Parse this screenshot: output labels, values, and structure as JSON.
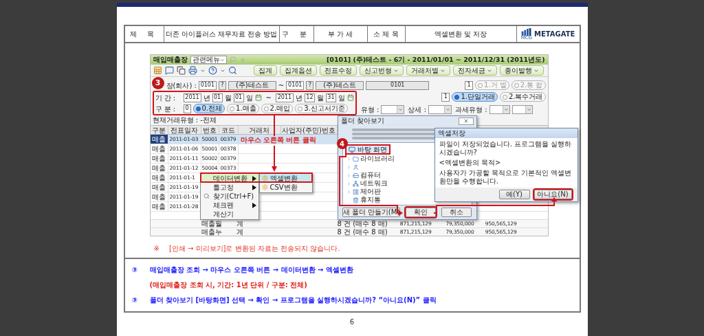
{
  "header": {
    "title_label": "제 목",
    "title": "더존 아이플러스 재무자료 전송 방법",
    "category_label": "구 분",
    "category": "부 가 세",
    "subtitle_label": "소 제 목",
    "subtitle": "엑셀변환 및 저장",
    "logo": {
      "name": "METAGATE",
      "sub": "MCG"
    }
  },
  "screenshot": {
    "title_bar": {
      "title": "매입매출장",
      "menu": "관련메뉴",
      "info": "[0101] (주)테스트 - 6기 - 2011/01/01 ~ 2011/12/31 (2011년도)"
    },
    "toolbar": [
      {
        "label": "집계",
        "dropdown": false
      },
      {
        "label": "집계옵션",
        "dropdown": false
      },
      {
        "label": "전표수정",
        "dropdown": false
      },
      {
        "label": "신고번형",
        "dropdown": true
      },
      {
        "label": "거래처별",
        "dropdown": true
      },
      {
        "label": "전자세금",
        "dropdown": true
      },
      {
        "label": "종이발행",
        "dropdown": true
      }
    ],
    "callout_3": "3",
    "company_row": {
      "label": "장(회사) :",
      "from_code": "0101",
      "from_help": "?",
      "from_name": "(주)테스트",
      "tilde": "~",
      "to_code": "0101",
      "to_help": "?",
      "to_name": "(주)테스트",
      "extra": "0101",
      "option_value": "1",
      "options": [
        {
          "label": "1.거 별",
          "selected": false,
          "disabled": true
        },
        {
          "label": "2.통 합",
          "selected": false,
          "disabled": true
        }
      ]
    },
    "period_row": {
      "label": "기 간 :",
      "from": [
        {
          "value": "2011",
          "unit": "년"
        },
        {
          "value": "01",
          "unit": "월"
        },
        {
          "value": "01",
          "unit": "일"
        }
      ],
      "tilde": "~",
      "to": [
        {
          "value": "2011",
          "unit": "년"
        },
        {
          "value": "12",
          "unit": "월"
        },
        {
          "value": "31",
          "unit": "일"
        }
      ],
      "option_value": "1",
      "options": [
        {
          "label": "1.단일거래",
          "selected": true
        },
        {
          "label": "2.복수거래",
          "selected": false
        }
      ]
    },
    "type_row": {
      "label": "구 분 :",
      "value": "0",
      "options": [
        {
          "label": "0.전체",
          "selected": true
        },
        {
          "label": "1.매출",
          "selected": false
        },
        {
          "label": "2.매입",
          "selected": false
        },
        {
          "label": "3.신고서기준",
          "selected": false
        }
      ],
      "filters": [
        {
          "label": "유형 :",
          "double": false
        },
        {
          "label": "상세 :",
          "double": false
        },
        {
          "label": "과세유형 :",
          "double": true
        }
      ]
    },
    "current_type": "현재거래유형 : -전체",
    "table": {
      "columns": [
        "구분",
        "전표일자",
        "번호",
        "코드",
        "거래처",
        "사업자(주민)번호"
      ],
      "rows": [
        {
          "type": "매출",
          "date": "2011-01-03",
          "number": "50001",
          "code": "00379",
          "selected": true
        },
        {
          "type": "매출",
          "date": "2011-01-06",
          "number": "50001",
          "code": "00378",
          "selected": false
        },
        {
          "type": "매출",
          "date": "2011-01-11",
          "number": "50002",
          "code": "00379",
          "selected": false
        },
        {
          "type": "매출",
          "date": "2011-01-12",
          "number": "50004",
          "code": "00373",
          "selected": false
        },
        {
          "type": "매출",
          "date": "2011-01-1",
          "selected": false
        },
        {
          "type": "매출",
          "date": "2011-01-19",
          "selected": false
        },
        {
          "type": "매출",
          "date": "2011-01-19",
          "selected": false
        },
        {
          "type": "매출",
          "date": "2011-01-28",
          "selected": false
        }
      ],
      "summary": [
        {
          "label": "매출월",
          "total": "계",
          "count": "8 건 (매수 8 매)",
          "amounts": [
            "871,215,129",
            "79,350,000",
            "950,565,129"
          ]
        },
        {
          "label": "매출누",
          "total": "계",
          "count": "8 건 (매수 8 매)",
          "amounts": [
            "871,215,129",
            "79,350,000",
            "950,565,129"
          ]
        }
      ]
    },
    "annotation": "마우스 오른쪽 버튼 클릭",
    "context_menu": [
      {
        "label": "데이터변환",
        "submenu": true,
        "icon": false,
        "selected": true
      },
      {
        "label": "틀고정",
        "submenu": true,
        "icon": false,
        "selected": false
      },
      {
        "label": "찾기(Ctrl+F)",
        "submenu": false,
        "icon": true,
        "selected": false
      },
      {
        "label": "체크펜",
        "submenu": true,
        "icon": false,
        "selected": false
      },
      {
        "label": "계산기",
        "submenu": false,
        "icon": false,
        "selected": false
      }
    ],
    "submenu": [
      {
        "label": "엑셀변환",
        "selected": true
      },
      {
        "label": "CSV변환",
        "selected": false
      }
    ],
    "folder_dialog": {
      "title": "폴더 찾아보기",
      "callout": "4",
      "tree": [
        {
          "label": "바탕 화면",
          "kind": "desktop",
          "selected": true,
          "children": [
            {
              "label": "라이브러리",
              "kind": "library",
              "expandable": true
            },
            {
              "kind": "user",
              "expandable": true
            },
            {
              "label": "컴퓨터",
              "kind": "computer",
              "expandable": true
            },
            {
              "label": "네트워크",
              "kind": "network",
              "expandable": true
            },
            {
              "label": "제어판",
              "kind": "control",
              "expandable": true
            },
            {
              "label": "휴지통",
              "kind": "trash",
              "expandable": false
            }
          ]
        }
      ],
      "buttons": [
        {
          "label": "새 폴더 만들기(M)",
          "marked": false
        },
        {
          "label": "확인",
          "marked": true
        },
        {
          "label": "취소",
          "marked": false
        }
      ]
    },
    "excel_dialog": {
      "title": "엑셀저장",
      "message": "파일이 저장되었습니다. 프로그램을 실행하시겠습니까?",
      "purpose_title": "<엑셀변환의 목적>",
      "purpose": "사용자가 가공할 목적으로 기본적인 엑셀변환만을 수행합니다.",
      "buttons": [
        {
          "label": "예(Y)",
          "marked": false
        },
        {
          "label": "아니요(N)",
          "marked": true
        }
      ]
    }
  },
  "note": {
    "mark": "※",
    "text": "[인쇄 → 미리보기]로 변환된 자료는 전송되지 않습니다."
  },
  "steps": [
    {
      "kind": "step",
      "mark": "③",
      "text": "매입매출장 조회 → 마우스 오른쪽 버튼 → 데이터변환 → 엑셀변환"
    },
    {
      "kind": "remark",
      "text": "(매입매출장 조회 시, 기간: 1년 단위 / 구분: 전체)"
    },
    {
      "kind": "step",
      "mark": "③",
      "text": "폴더 찾아보기 [바탕화면] 선택 → 확인 → 프로그램을 실행하시겠습니까? “아니요(N)” 클릭"
    }
  ],
  "page_number": "6"
}
